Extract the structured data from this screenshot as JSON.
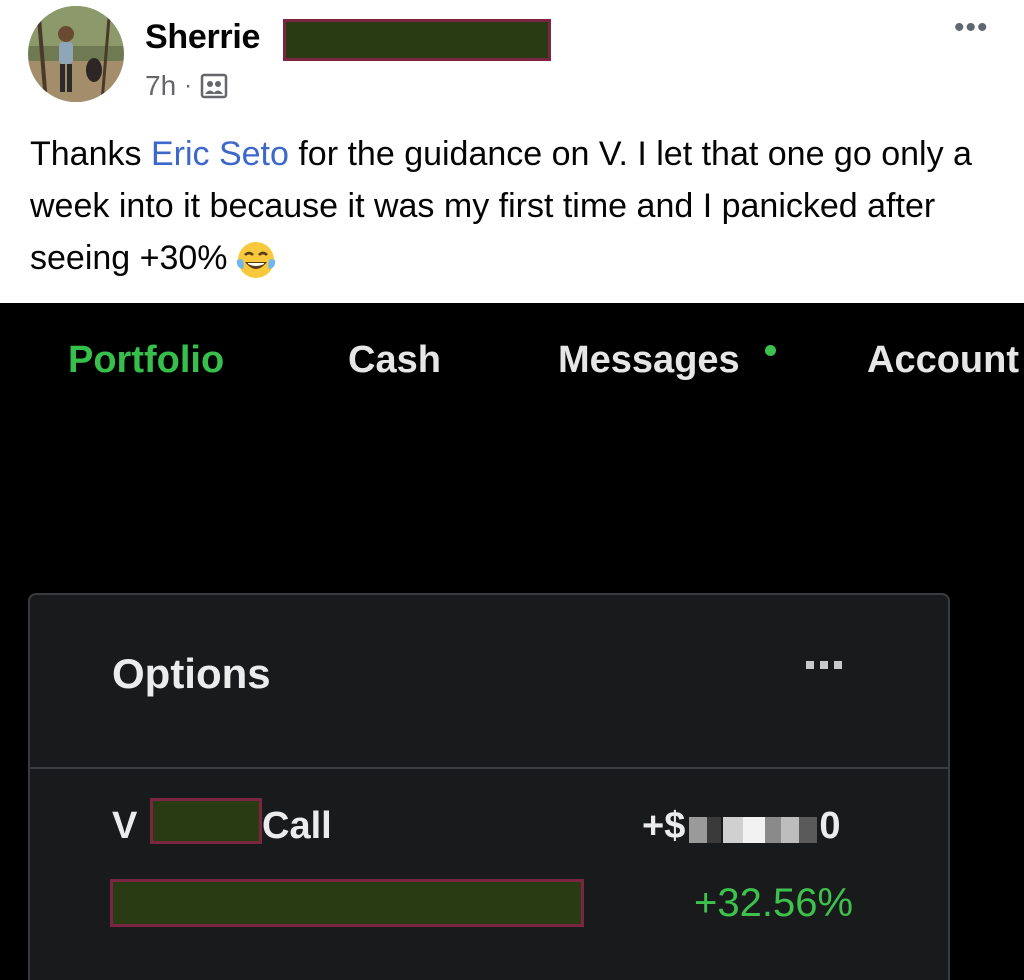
{
  "post": {
    "author": "Sherrie",
    "time": "7h",
    "meta_sep": "·",
    "audience_icon": "group-privacy-icon",
    "more_icon": "more-options-icon",
    "more_label": "•••",
    "text_before": "Thanks ",
    "mention": "Eric Seto",
    "text_after": " for the guidance on V. I let that one go only a week into it because it was my first time and I panicked after seeing +30%",
    "emoji": "tears-of-joy-emoji"
  },
  "app": {
    "tabs": [
      {
        "label": "Portfolio",
        "active": true
      },
      {
        "label": "Cash"
      },
      {
        "label": "Messages",
        "badge": "unread-dot"
      },
      {
        "label": "Account"
      }
    ],
    "active_color": "#36c04b",
    "card": {
      "title": "Options",
      "more_icon": "more-dots-icon",
      "position": {
        "symbol": "V",
        "type": "Call",
        "pl_prefix": "+$",
        "pl_suffix": "0",
        "pl_percent": "+32.56%"
      }
    }
  },
  "colors": {
    "redaction_fill": "#283b12",
    "redaction_border": "#7b2640",
    "mention": "#3b68c9",
    "gain": "#3cc24d"
  }
}
